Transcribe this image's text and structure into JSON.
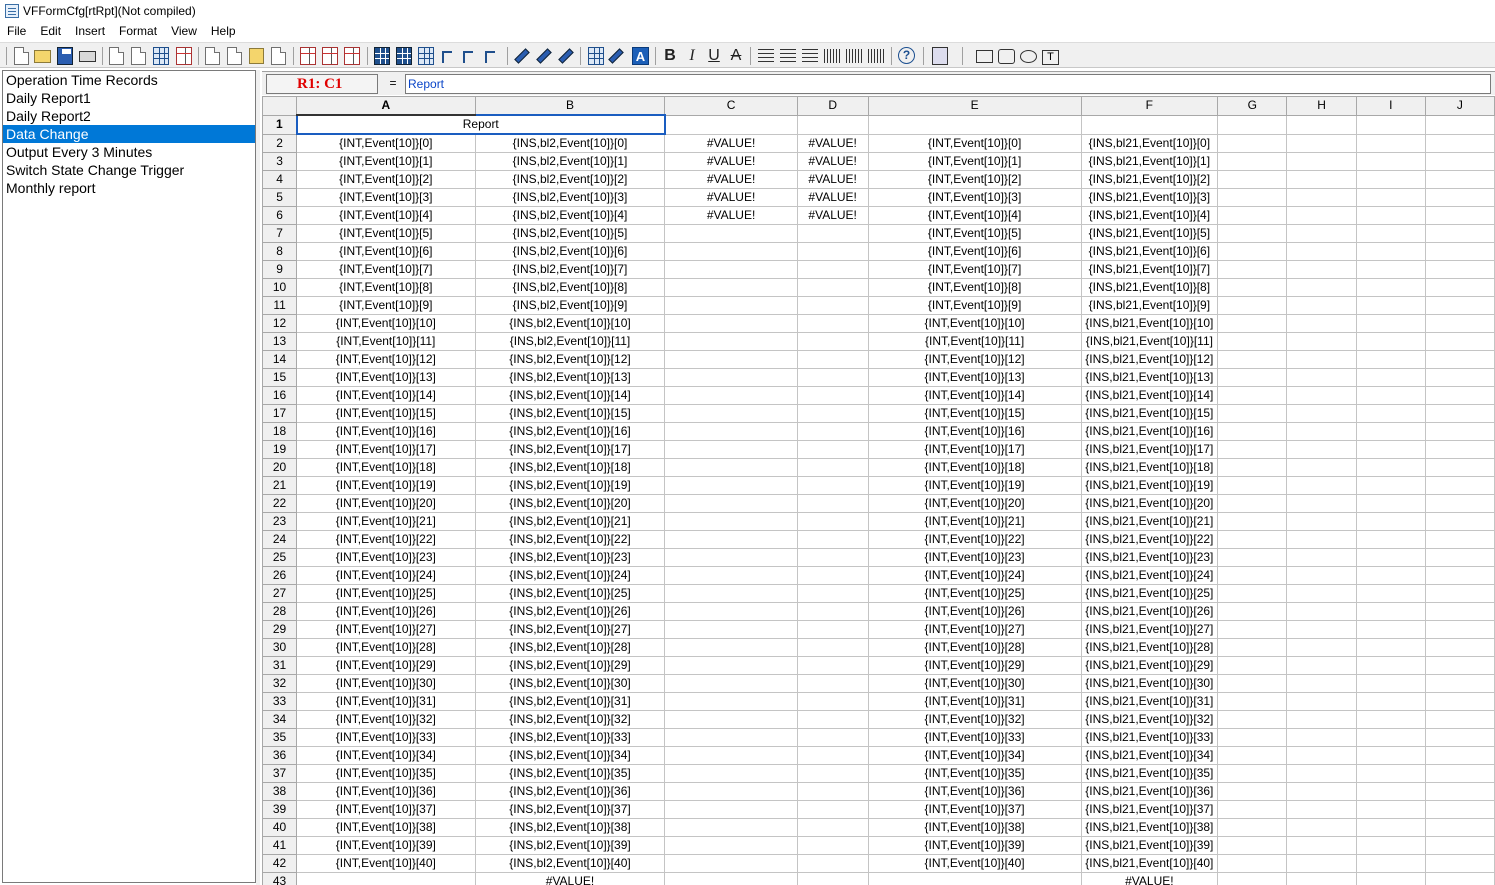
{
  "window": {
    "title": "VFFormCfg[rtRpt](Not compiled)"
  },
  "menu": [
    "File",
    "Edit",
    "Insert",
    "Format",
    "View",
    "Help"
  ],
  "toolbar": {
    "icons": [
      "new-document-icon",
      "open-folder-icon",
      "save-icon",
      "print-icon",
      "export-icon",
      "import-icon",
      "table-icon",
      "grid-settings-icon",
      "insert-row-icon",
      "delete-row-icon",
      "insert-table-icon",
      "table-grid-icon",
      "table-properties-icon",
      "merge-cells-icon",
      "split-cells-icon",
      "chart-icon",
      "pen-icon",
      "paint-bucket-icon",
      "highlighter-icon",
      "font-settings-icon",
      "fill-color-icon",
      "font-color-icon",
      "bold-icon",
      "italic-icon",
      "underline-icon",
      "strikethrough-icon",
      "align-left-icon",
      "align-center-icon",
      "align-right-icon",
      "barcode-icon",
      "barcode2-icon",
      "barcode3-icon",
      "help-icon",
      "select-icon",
      "rectangle-icon",
      "rounded-rectangle-icon",
      "oval-icon",
      "text-box-icon"
    ],
    "letters": {
      "bold": "B",
      "italic": "I",
      "underline": "U",
      "strike": "A",
      "font_color": "A",
      "help": "?",
      "textbox": "T"
    }
  },
  "report_list": {
    "items": [
      "Operation Time Records",
      "Daily Report1",
      "Daily Report2",
      "Data Change",
      "Output Every 3 Minutes",
      "Switch State Change Trigger",
      "Monthly report"
    ],
    "selected_index": 3
  },
  "formula_bar": {
    "cell_ref": "R1: C1",
    "equals": "=",
    "content": "Report"
  },
  "sheet": {
    "columns": [
      "A",
      "B",
      "C",
      "D",
      "E",
      "F",
      "G",
      "H",
      "I",
      "J"
    ],
    "active_col": "A",
    "active_row": 1,
    "row1_merged": "Report",
    "value_error": "#VALUE!",
    "col_a_prefix": "{INT,Event[10]}",
    "col_b_prefix": "{INS,bl2,Event[10]}",
    "col_e_prefix": "{INT,Event[10]}",
    "col_f_prefix": "{INS,bl21,Event[10]}",
    "data_rows_from": 2,
    "data_rows_to": 42,
    "error_rows_cd_to": 6,
    "last_row": 43,
    "last_row_cells": {
      "B": "#VALUE!",
      "F": "#VALUE!"
    }
  }
}
